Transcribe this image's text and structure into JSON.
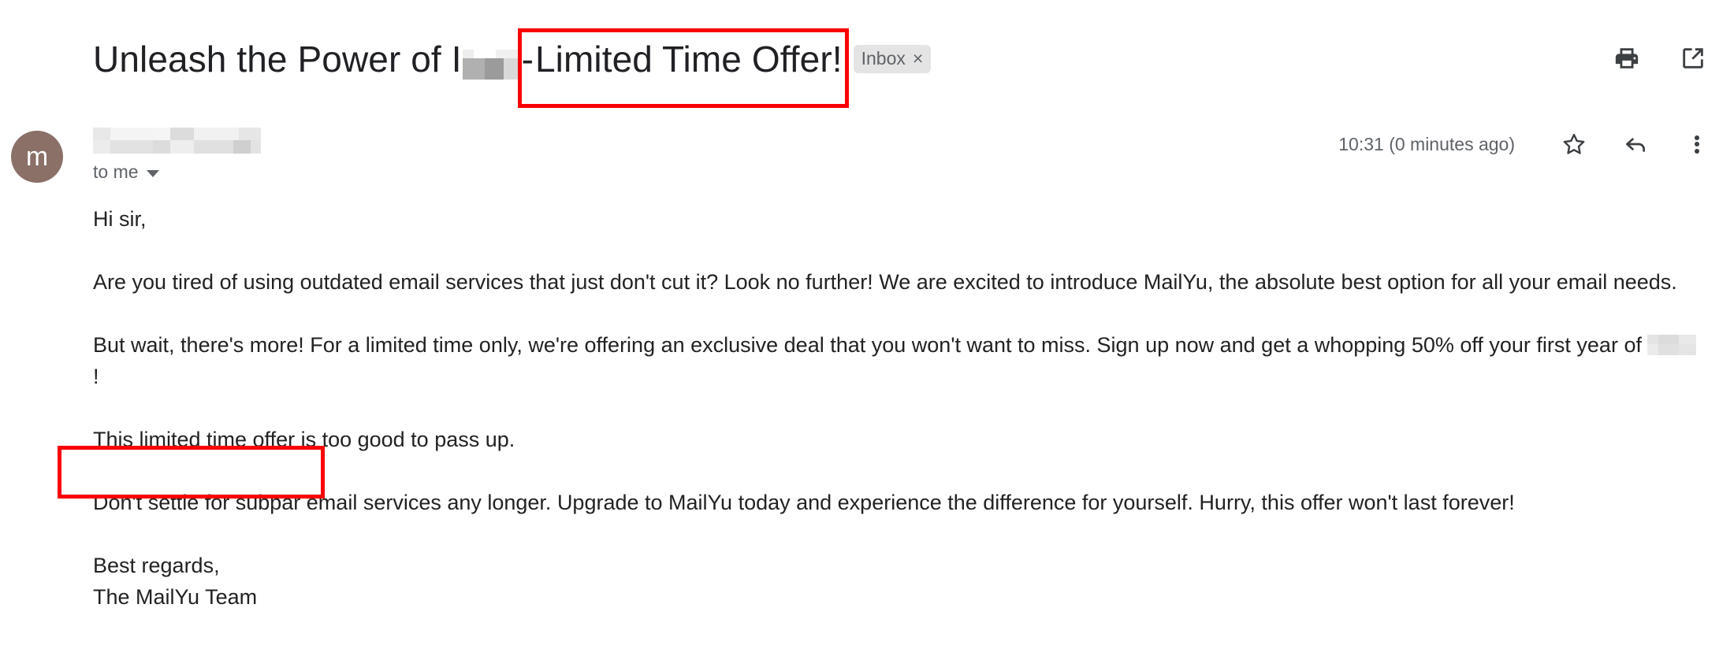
{
  "subject": {
    "part_a": "Unleash the Power of I",
    "redaction": "redacted-product-name",
    "separator": "-",
    "part_b": "Limited Time Offer!"
  },
  "label_chip": {
    "name": "Inbox",
    "remove": "×"
  },
  "header_actions": [
    {
      "name": "print-icon",
      "label": "Print all"
    },
    {
      "name": "open-in-new-window-icon",
      "label": "Open in new window"
    }
  ],
  "sender": {
    "avatar_initial": "m",
    "name_redaction": "redacted-sender-name",
    "recipient": "to me",
    "recipient_caret": "show-details-caret"
  },
  "meta": {
    "timestamp": "10:31 (0 minutes ago)",
    "star_label": "Star",
    "reply_label": "Reply",
    "more_label": "More"
  },
  "body": {
    "greeting": "Hi sir,",
    "paragraph_1": "Are you tired of using outdated email services that just don't cut it? Look no further! We are excited to introduce MailYu, the absolute best option for all your email needs.",
    "paragraph_2_before": "But wait, there's more! For a limited time only, we're offering an exclusive deal that you won't want to miss. Sign up now and get a whopping 50% off your first year of ",
    "paragraph_2_redaction": "redacted-product-name",
    "paragraph_2_after": "!",
    "paragraph_3_highlight": "This limited time offer",
    "paragraph_3_rest": " is too good to pass up.",
    "paragraph_4": "Don't settle for subpar email services any longer. Upgrade to MailYu today and experience the difference for yourself. Hurry, this offer won't last forever!",
    "signoff_line_1": "Best regards,",
    "signoff_line_2": "The MailYu Team"
  },
  "annotations": {
    "color": "#fa0000",
    "box_1_target": "Limited Time Offer!",
    "box_2_target": "This limited time offer"
  }
}
